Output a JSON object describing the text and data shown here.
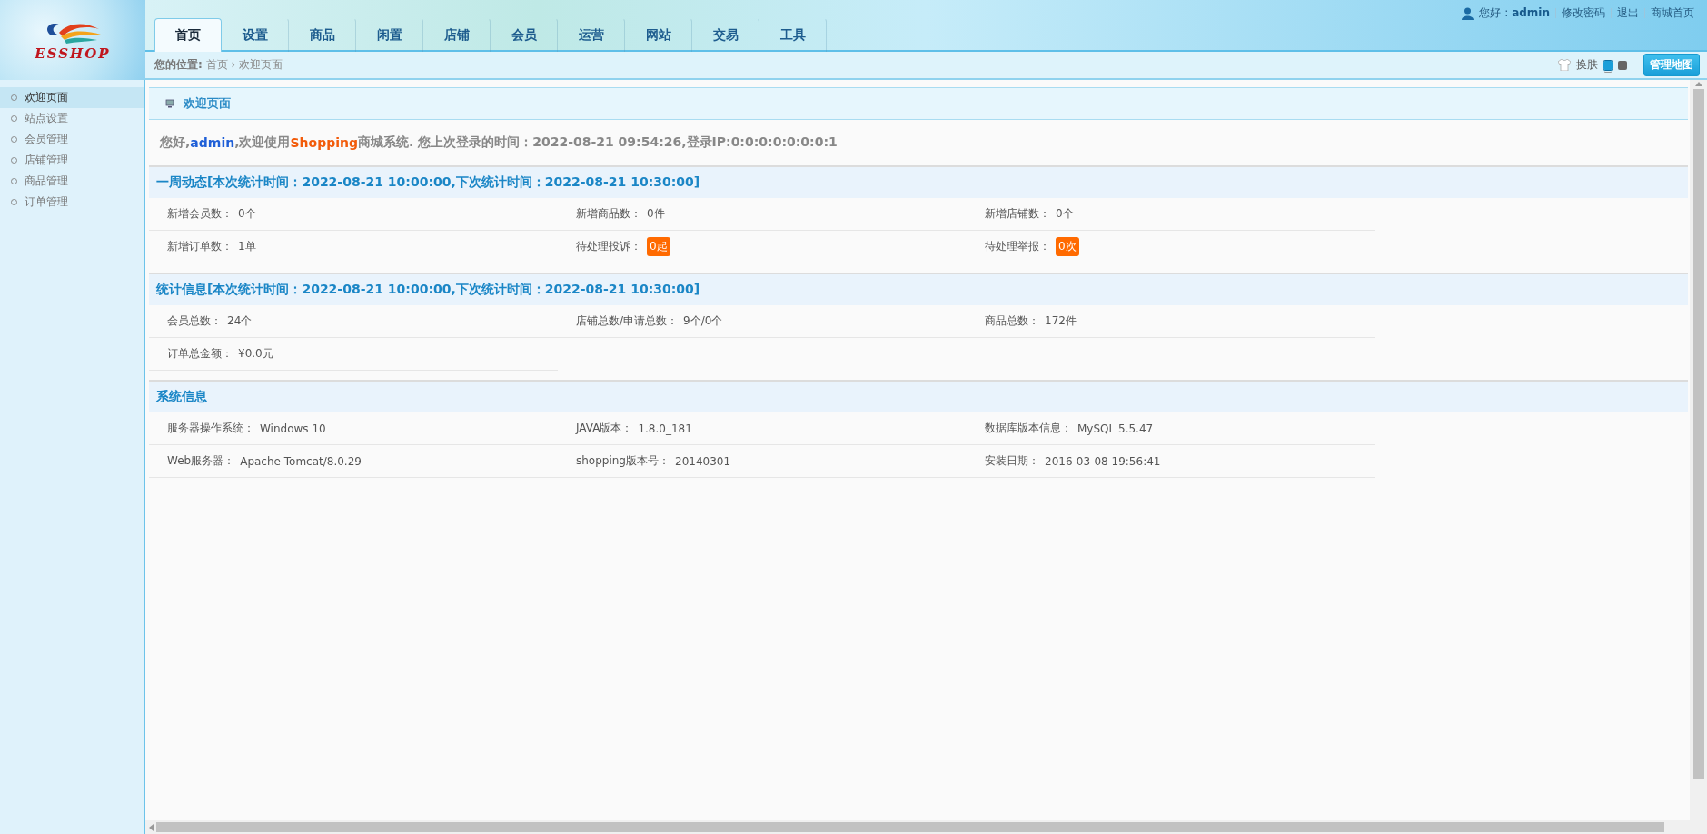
{
  "logo": {
    "text": "ESSHOP"
  },
  "nav": [
    {
      "label": "首页",
      "selected": true
    },
    {
      "label": "设置",
      "selected": false
    },
    {
      "label": "商品",
      "selected": false
    },
    {
      "label": "闲置",
      "selected": false
    },
    {
      "label": "店铺",
      "selected": false
    },
    {
      "label": "会员",
      "selected": false
    },
    {
      "label": "运营",
      "selected": false
    },
    {
      "label": "网站",
      "selected": false
    },
    {
      "label": "交易",
      "selected": false
    },
    {
      "label": "工具",
      "selected": false
    }
  ],
  "user_bar": {
    "greeting": "您好 : ",
    "user": "admin",
    "links": [
      "修改密码",
      "退出",
      "商城首页"
    ]
  },
  "breadcrumb": {
    "label": "您的位置:",
    "items": [
      "首页",
      "欢迎页面"
    ],
    "separator": "›"
  },
  "skin": {
    "label": "换肤",
    "swatches": [
      {
        "color": "#1a9fd9",
        "selected": true
      },
      {
        "color": "#666666",
        "selected": false
      }
    ]
  },
  "map_button": "管理地图",
  "sidebar": {
    "items": [
      {
        "label": "欢迎页面",
        "selected": true
      },
      {
        "label": "站点设置",
        "selected": false
      },
      {
        "label": "会员管理",
        "selected": false
      },
      {
        "label": "店铺管理",
        "selected": false
      },
      {
        "label": "商品管理",
        "selected": false
      },
      {
        "label": "订单管理",
        "selected": false
      }
    ]
  },
  "page_title": "欢迎页面",
  "greeting": {
    "prefix": "您好,",
    "user": "admin",
    "middle": ",欢迎使用",
    "brand": "Shopping",
    "suffix": "商城系统. 您上次登录的时间：2022-08-21 09:54:26,登录IP:0:0:0:0:0:0:0:1"
  },
  "sections": [
    {
      "title": "一周动态[本次统计时间：2022-08-21 10:00:00,下次统计时间：2022-08-21 10:30:00]",
      "items": [
        {
          "label": "新增会员数：",
          "value": "0个",
          "kind": "plain"
        },
        {
          "label": "新增商品数：",
          "value": "0件",
          "kind": "plain"
        },
        {
          "label": "新增店铺数：",
          "value": "0个",
          "kind": "plain"
        },
        {
          "label": "新增订单数：",
          "value": "1单",
          "kind": "plain"
        },
        {
          "label": "待处理投诉：",
          "value": "0起",
          "kind": "badge"
        },
        {
          "label": "待处理举报：",
          "value": "0次",
          "kind": "badge"
        }
      ]
    },
    {
      "title": "统计信息[本次统计时间：2022-08-21 10:00:00,下次统计时间：2022-08-21 10:30:00]",
      "items": [
        {
          "label": "会员总数：",
          "value": "24个",
          "kind": "plain"
        },
        {
          "label": "店铺总数/申请总数：",
          "value": "9个/0个",
          "kind": "plain"
        },
        {
          "label": "商品总数：",
          "value": "172件",
          "kind": "plain"
        },
        {
          "label": "订单总金额：",
          "value": "¥0.0元",
          "kind": "plain"
        }
      ]
    },
    {
      "title": "系统信息",
      "items": [
        {
          "label": "服务器操作系统：",
          "value": "Windows 10",
          "kind": "plain"
        },
        {
          "label": "JAVA版本：",
          "value": "1.8.0_181",
          "kind": "plain"
        },
        {
          "label": "数据库版本信息：",
          "value": "MySQL 5.5.47",
          "kind": "plain"
        },
        {
          "label": "Web服务器：",
          "value": "Apache Tomcat/8.0.29",
          "kind": "plain"
        },
        {
          "label": "shopping版本号：",
          "value": "20140301",
          "kind": "plain"
        },
        {
          "label": "安装日期：",
          "value": "2016-03-08 19:56:41",
          "kind": "plain"
        }
      ]
    }
  ]
}
